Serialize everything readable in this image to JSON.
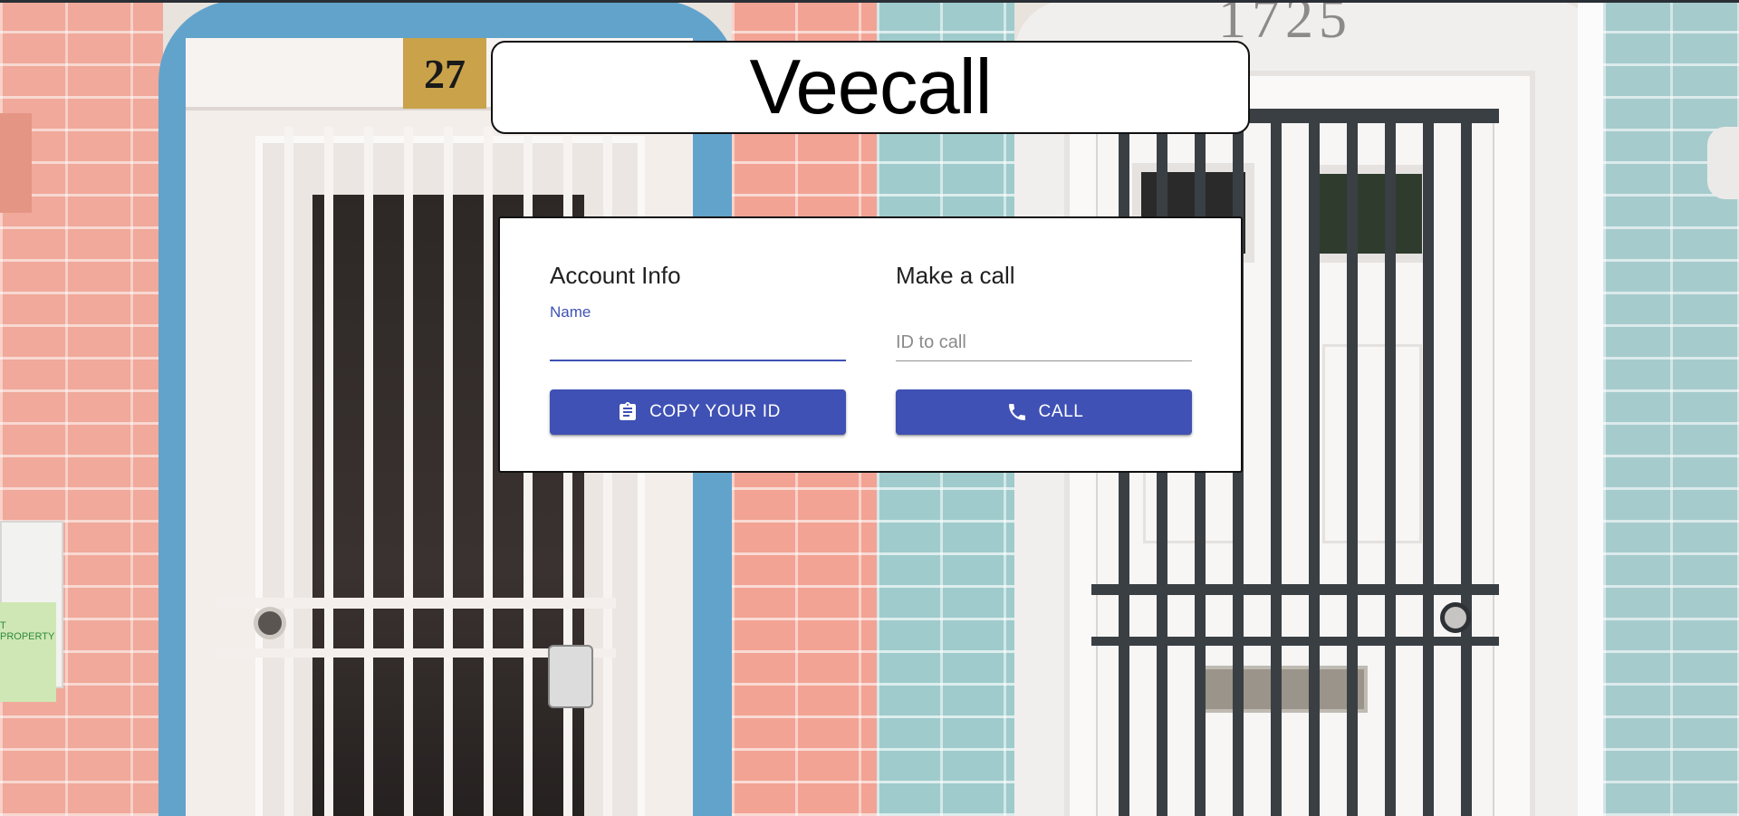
{
  "app": {
    "title": "Veecall"
  },
  "background": {
    "house_number": "27",
    "street_number": "1725",
    "flyer_text": "T PROPERTY"
  },
  "account_info": {
    "heading": "Account Info",
    "name_label": "Name",
    "name_value": "",
    "copy_button_label": "COPY YOUR ID",
    "copy_button_icon": "clipboard-icon"
  },
  "make_call": {
    "heading": "Make a call",
    "id_placeholder": "ID to call",
    "id_value": "",
    "call_button_label": "CALL",
    "call_button_icon": "phone-icon"
  },
  "colors": {
    "primary": "#3f51b5",
    "card_bg": "#ffffff",
    "border": "#111111"
  }
}
